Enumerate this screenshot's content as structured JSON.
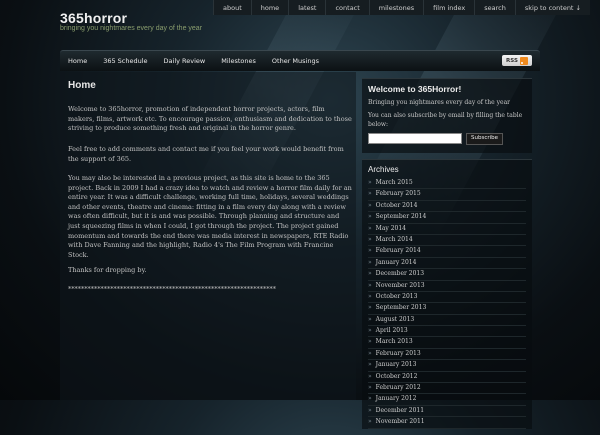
{
  "site": {
    "title": "365horror",
    "tagline": "bringing you nightmares every day of the year"
  },
  "top_nav": [
    "about",
    "home",
    "latest",
    "contact",
    "milestones",
    "film index",
    "search",
    "skip to content ↓"
  ],
  "main_nav": [
    "Home",
    "365 Schedule",
    "Daily Review",
    "Milestones",
    "Other Musings"
  ],
  "rss_label": "RSS",
  "page": {
    "title": "Home",
    "paragraphs": [
      "Welcome to 365horror, promotion of independent horror projects, actors, film makers, films, artwork etc. To encourage passion, enthusiasm and dedication to those striving to produce something fresh and original in the horror genre.",
      "Feel free to add comments and contact me if you feel your work would benefit from the support of 365.",
      "You may also be interested in a previous project, as this site is home to the 365 project. Back in 2009 I had a crazy idea to watch and review a horror film daily for an entire year. It was a difficult challenge, working full time, holidays, several weddings and other events, theatre and cinema: fitting in a film every day along with a review was often difficult, but it is and was possible. Through planning and structure and just squeezing films in when I could, I got through the project. The project gained momentum and towards the end there was media interest in newspapers, RTE Radio with Dave Fanning and the highlight, Radio 4's The Film Program with Francine Stock.",
      "Thanks for dropping by.",
      "****************************************************************"
    ]
  },
  "sidebar": {
    "welcome_title": "Welcome to 365Horror!",
    "welcome_text": "Bringing you nightmares every day of the year",
    "subscribe_text": "You can also subscribe by email by filling the table below:",
    "subscribe_button": "Subscribe",
    "archives_title": "Archives",
    "archives": [
      "March 2015",
      "February 2015",
      "October 2014",
      "September 2014",
      "May 2014",
      "March 2014",
      "February 2014",
      "January 2014",
      "December 2013",
      "November 2013",
      "October 2013",
      "September 2013",
      "August 2013",
      "April 2013",
      "March 2013",
      "February 2013",
      "January 2013",
      "October 2012",
      "February 2012",
      "January 2012",
      "December 2011",
      "November 2011"
    ]
  }
}
